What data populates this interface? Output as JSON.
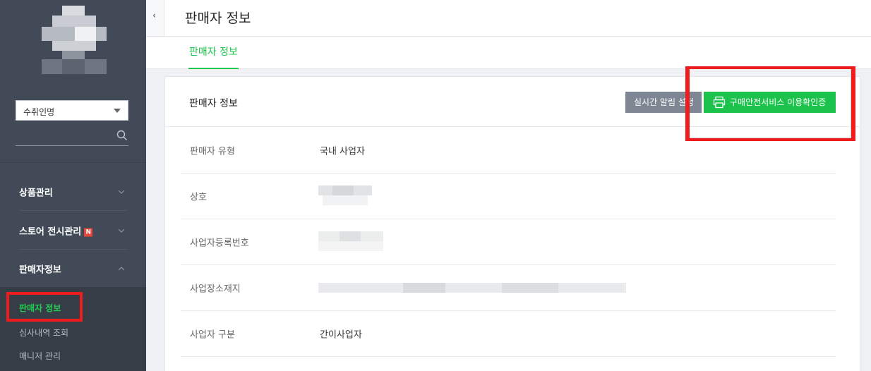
{
  "sidebar": {
    "store_select": {
      "value": "수취인명"
    },
    "menu": [
      {
        "label": "상품관리",
        "badge": ""
      },
      {
        "label": "스토어 전시관리",
        "badge": "N"
      },
      {
        "label": "판매자정보",
        "badge": ""
      }
    ],
    "submenu": [
      {
        "label": "판매자 정보"
      },
      {
        "label": "심사내역 조회"
      },
      {
        "label": "매니저 관리"
      }
    ]
  },
  "header": {
    "title": "판매자 정보",
    "collapse_glyph": "‹"
  },
  "tabs": [
    {
      "label": "판매자 정보"
    }
  ],
  "card": {
    "title": "판매자 정보",
    "buttons": {
      "alert_label": "실시간 알림 설정",
      "verify_label": "구매안전서비스 이용확인증"
    },
    "rows": [
      {
        "label": "판매자 유형",
        "value": "국내 사업자"
      },
      {
        "label": "상호",
        "value": ""
      },
      {
        "label": "사업자등록번호",
        "value": ""
      },
      {
        "label": "사업장소재지",
        "value": ""
      },
      {
        "label": "사업자 구분",
        "value": "간이사업자"
      }
    ]
  },
  "colors": {
    "sidebar_bg": "#414a56",
    "accent_green": "#1ec84c",
    "button_gray": "#7d8692",
    "highlight_red": "#ee1c1c"
  },
  "icons": {
    "search": "search-icon",
    "chevron_down": "chevron-down-icon",
    "chevron_up": "chevron-up-icon",
    "printer": "printer-icon",
    "collapse": "chevron-left-icon"
  }
}
